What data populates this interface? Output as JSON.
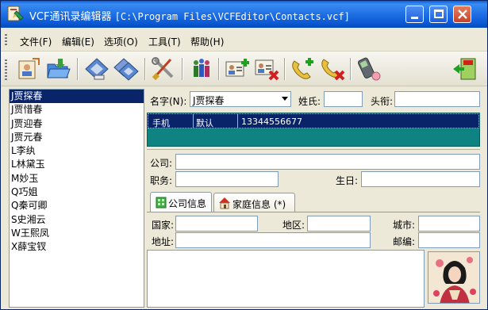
{
  "window": {
    "app_name": "VCF通讯录编辑器",
    "file_path": "[C:\\Program Files\\VCFEditor\\Contacts.vcf]"
  },
  "menu": [
    {
      "label": "文件(F)"
    },
    {
      "label": "编辑(E)"
    },
    {
      "label": "选项(O)"
    },
    {
      "label": "工具(T)"
    },
    {
      "label": "帮助(H)"
    }
  ],
  "toolbar": {
    "icons": [
      "new-contact-icon",
      "open-file-icon",
      "disk-icon",
      "multi-disk-icon",
      "tools-icon",
      "people-icon",
      "add-card-icon",
      "delete-card-icon",
      "add-phone-icon",
      "delete-phone-icon",
      "mobile-phone-icon",
      "exit-icon"
    ]
  },
  "contacts": [
    "J贾探春",
    "J贾惜春",
    "J贾迎春",
    "J贾元春",
    "L李纨",
    "L林黛玉",
    "M妙玉",
    "Q巧姐",
    "Q秦可卿",
    "S史湘云",
    "W王熙凤",
    "X薛宝钗"
  ],
  "selected_contact_index": 0,
  "form": {
    "name_label": "名字(N):",
    "name_value": "J贾探春",
    "surname_label": "姓氏:",
    "surname_value": "",
    "title_label": "头衔:",
    "title_value": "",
    "company_label": "公司:",
    "company_value": "",
    "position_label": "职务:",
    "position_value": "",
    "birthday_label": "生日:",
    "birthday_value": ""
  },
  "phones": [
    {
      "type": "手机",
      "flag": "默认",
      "number": "13344556677"
    }
  ],
  "tabs": [
    {
      "label": "公司信息",
      "active": true
    },
    {
      "label": "家庭信息 (*)",
      "active": false
    }
  ],
  "address": {
    "country_label": "国家:",
    "region_label": "地区:",
    "city_label": "城市:",
    "address_label": "地址:",
    "postcode_label": "邮编:"
  },
  "colors": {
    "title_bar": "#1f6fe4",
    "selection": "#0a246a",
    "phone_panel": "#0f8282",
    "window_bg": "#ece9d8"
  }
}
